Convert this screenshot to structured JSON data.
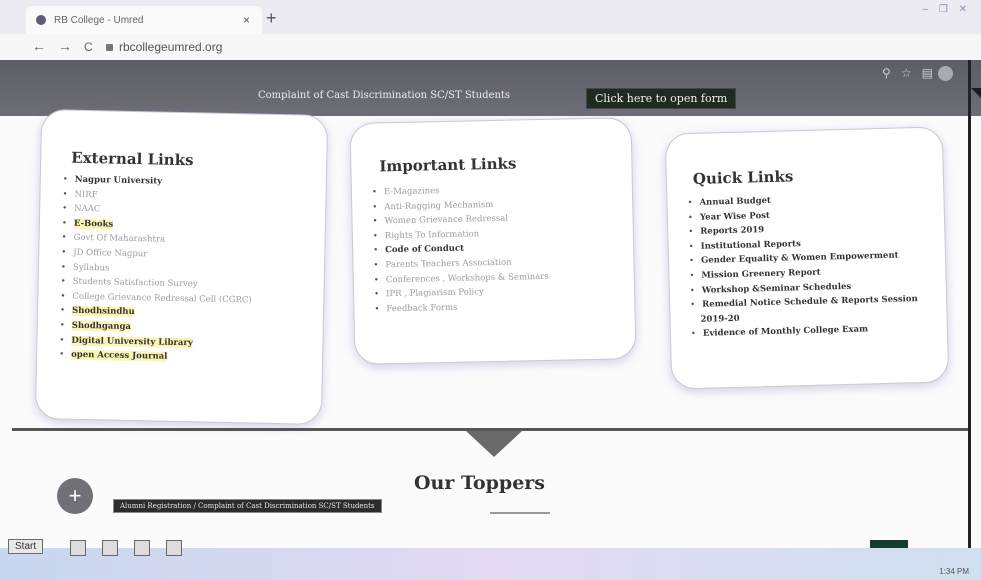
{
  "browser": {
    "tab_title": "RB College - Umred",
    "tab_close": "×",
    "new_tab": "+",
    "url": "rbcollegeumred.org",
    "back": "←",
    "forward": "→",
    "reload": "C"
  },
  "notice": {
    "text": "Complaint of Cast Discrimination SC/ST Students",
    "button": "Click here to open form"
  },
  "external_links": {
    "title": "External Links",
    "items": [
      {
        "label": "Nagpur University",
        "style": "bold"
      },
      {
        "label": "NIRF",
        "style": "muted"
      },
      {
        "label": "NAAC",
        "style": "muted"
      },
      {
        "label": "E-Books",
        "style": "bold",
        "highlight": true
      },
      {
        "label": "Govt Of Maharashtra",
        "style": "muted"
      },
      {
        "label": "JD Office Nagpur",
        "style": "muted"
      },
      {
        "label": "Syllabus",
        "style": "muted"
      },
      {
        "label": "Students Satisfaction Survey",
        "style": "muted"
      },
      {
        "label": "College Grievance Redressal Cell (CGRC)",
        "style": "muted"
      },
      {
        "label": "Shodhsindhu",
        "style": "bold",
        "highlight": true
      },
      {
        "label": "Shodhganga",
        "style": "bold",
        "highlight": true
      },
      {
        "label": "Digital University Library",
        "style": "bold",
        "highlight": true
      },
      {
        "label": "open Access Journal",
        "style": "bold",
        "highlight": true
      }
    ]
  },
  "important_links": {
    "title": "Important Links",
    "items": [
      {
        "label": "E-Magazines",
        "style": "muted"
      },
      {
        "label": "Anti-Ragging Mechanism",
        "style": "muted"
      },
      {
        "label": "Women Grievance Redressal",
        "style": "muted"
      },
      {
        "label": "Rights To Information",
        "style": "muted"
      },
      {
        "label": "Code of Conduct",
        "style": "bold"
      },
      {
        "label": "Parents Teachers Association",
        "style": "muted"
      },
      {
        "label": "Conferences , Workshops & Seminars",
        "style": "muted"
      },
      {
        "label": "IPR , Plagiarism Policy",
        "style": "muted"
      },
      {
        "label": "Feedback Forms",
        "style": "muted"
      }
    ]
  },
  "quick_links": {
    "title": "Quick Links",
    "items": [
      {
        "label": "Annual Budget",
        "style": "bold"
      },
      {
        "label": "Year Wise Post",
        "style": "bold"
      },
      {
        "label": "Reports 2019",
        "style": "bold"
      },
      {
        "label": "Institutional Reports",
        "style": "bold"
      },
      {
        "label": "Gender Equality & Women Empowerment",
        "style": "bold"
      },
      {
        "label": "Mission Greenery Report",
        "style": "bold"
      },
      {
        "label": "Workshop &Seminar Schedules",
        "style": "bold"
      },
      {
        "label": "Remedial Notice Schedule & Reports Session",
        "style": "bold"
      },
      {
        "label": "2019-20",
        "style": "bold",
        "continuation": true
      },
      {
        "label": "Evidence of Monthly College Exam",
        "style": "bold"
      }
    ]
  },
  "toppers": {
    "heading": "Our Toppers",
    "fab": "+",
    "tooltip": "Alumni Registration / Complaint of Cast Discrimination SC/ST Students"
  },
  "scroll_top": "^",
  "taskbar": {
    "start": "Start",
    "tray_time": "1:34 PM"
  },
  "colors": {
    "notice_strip": "#66666e",
    "form_button": "#1f2b1f",
    "highlight": "#fbf6b6",
    "scroll_top": "#153b2b"
  }
}
